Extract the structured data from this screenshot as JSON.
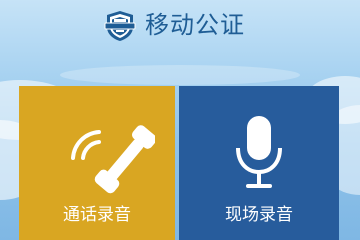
{
  "header": {
    "title": "移动公证",
    "logo_icon": "notary-badge-icon"
  },
  "tiles": [
    {
      "label": "通话录音",
      "icon": "phone-handset-icon",
      "color": "#d9a622"
    },
    {
      "label": "现场录音",
      "icon": "microphone-icon",
      "color": "#275c9c"
    }
  ],
  "colors": {
    "title": "#1f5d95",
    "sky": "#a9d3f1"
  }
}
